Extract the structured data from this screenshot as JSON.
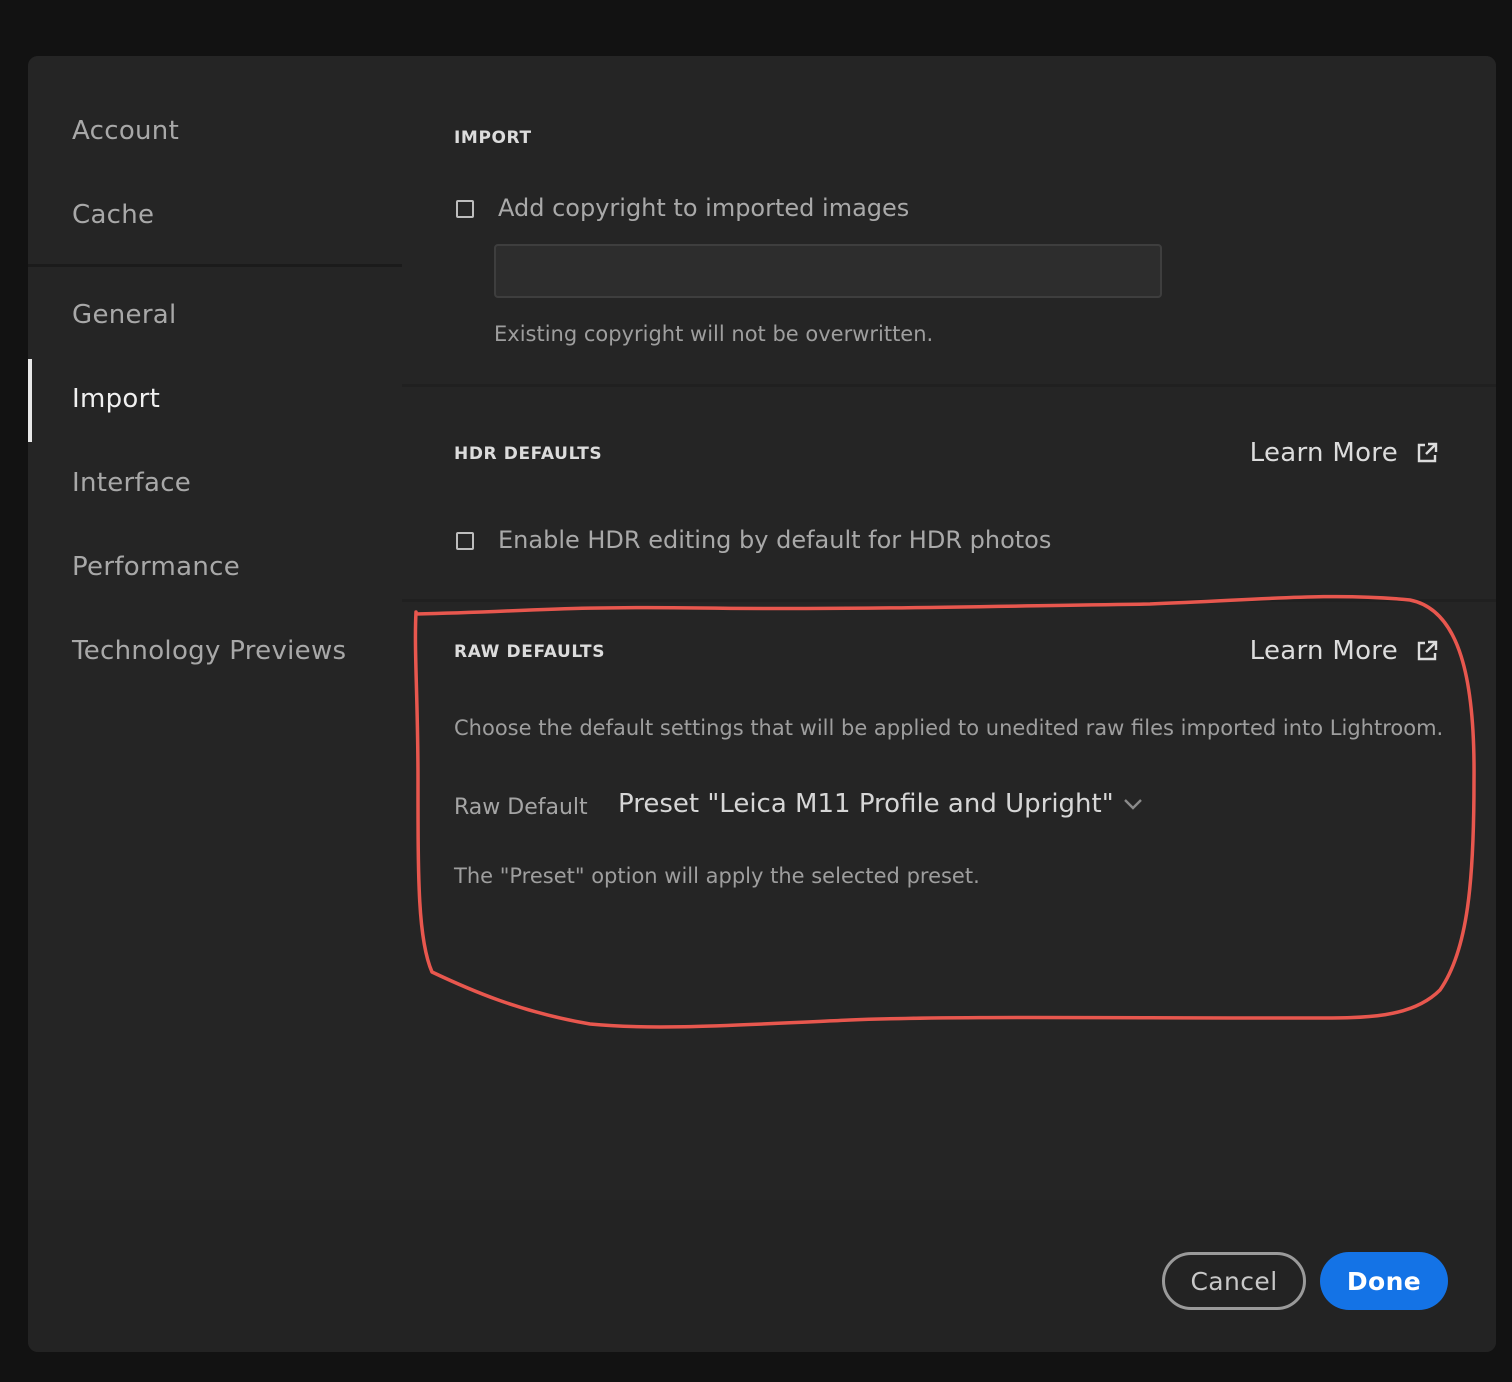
{
  "sidebar": {
    "items": [
      {
        "label": "Account"
      },
      {
        "label": "Cache"
      },
      {
        "label": "General"
      },
      {
        "label": "Import"
      },
      {
        "label": "Interface"
      },
      {
        "label": "Performance"
      },
      {
        "label": "Technology Previews"
      }
    ],
    "active_item": "Import"
  },
  "import_section": {
    "title": "IMPORT",
    "copyright_checkbox_label": "Add copyright to imported images",
    "copyright_checked": false,
    "copyright_value": "",
    "help": "Existing copyright will not be overwritten."
  },
  "hdr_section": {
    "title": "HDR DEFAULTS",
    "learn_more": "Learn More",
    "hdr_checkbox_label": "Enable HDR editing by default for HDR photos",
    "hdr_checked": false
  },
  "raw_section": {
    "title": "RAW DEFAULTS",
    "learn_more": "Learn More",
    "description": "Choose the default settings that will be applied to unedited raw files imported into Lightroom.",
    "raw_default_label": "Raw Default",
    "raw_default_value": "Preset \"Leica M11 Profile and Upright\"",
    "preset_note": "The \"Preset\" option will apply the selected preset."
  },
  "footer": {
    "cancel_label": "Cancel",
    "done_label": "Done"
  },
  "colors": {
    "accent": "#1473e6",
    "annotation": "#e8574e",
    "background": "#232323"
  }
}
